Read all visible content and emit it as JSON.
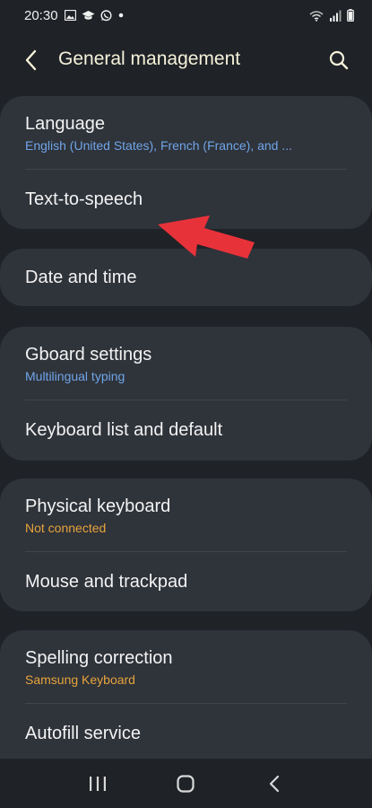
{
  "status": {
    "time": "20:30",
    "left_icons": [
      "image-icon",
      "graduation-cap-icon",
      "whatsapp-icon",
      "dot-icon"
    ],
    "right_icons": [
      "wifi-icon",
      "signal-icon",
      "battery-icon"
    ]
  },
  "header": {
    "title": "General management",
    "back_icon": "chevron-left-icon",
    "search_icon": "search-icon"
  },
  "groups": [
    {
      "items": [
        {
          "title": "Language",
          "subtitle": "English (United States), French (France), and ...",
          "subtitle_color": "#6fa5e8"
        },
        {
          "title": "Text-to-speech",
          "subtitle": ""
        }
      ]
    },
    {
      "items": [
        {
          "title": "Date and time",
          "subtitle": ""
        }
      ]
    },
    {
      "items": [
        {
          "title": "Gboard settings",
          "subtitle": "Multilingual typing",
          "subtitle_color": "#6fa5e8"
        },
        {
          "title": "Keyboard list and default",
          "subtitle": ""
        }
      ]
    },
    {
      "items": [
        {
          "title": "Physical keyboard",
          "subtitle": "Not connected",
          "subtitle_color": "#e7a43c"
        },
        {
          "title": "Mouse and trackpad",
          "subtitle": ""
        }
      ]
    },
    {
      "items": [
        {
          "title": "Spelling correction",
          "subtitle": "Samsung Keyboard",
          "subtitle_color": "#e7a43c"
        },
        {
          "title": "Autofill service",
          "subtitle": ""
        }
      ]
    }
  ],
  "nav": {
    "recents_icon": "recents-icon",
    "home_icon": "home-icon",
    "back_icon": "back-icon"
  },
  "colors": {
    "background": "#1f2227",
    "card": "#2f333a",
    "accent_blue": "#6fa5e8",
    "accent_orange": "#e7a43c",
    "annotation_red": "#e8323a"
  }
}
